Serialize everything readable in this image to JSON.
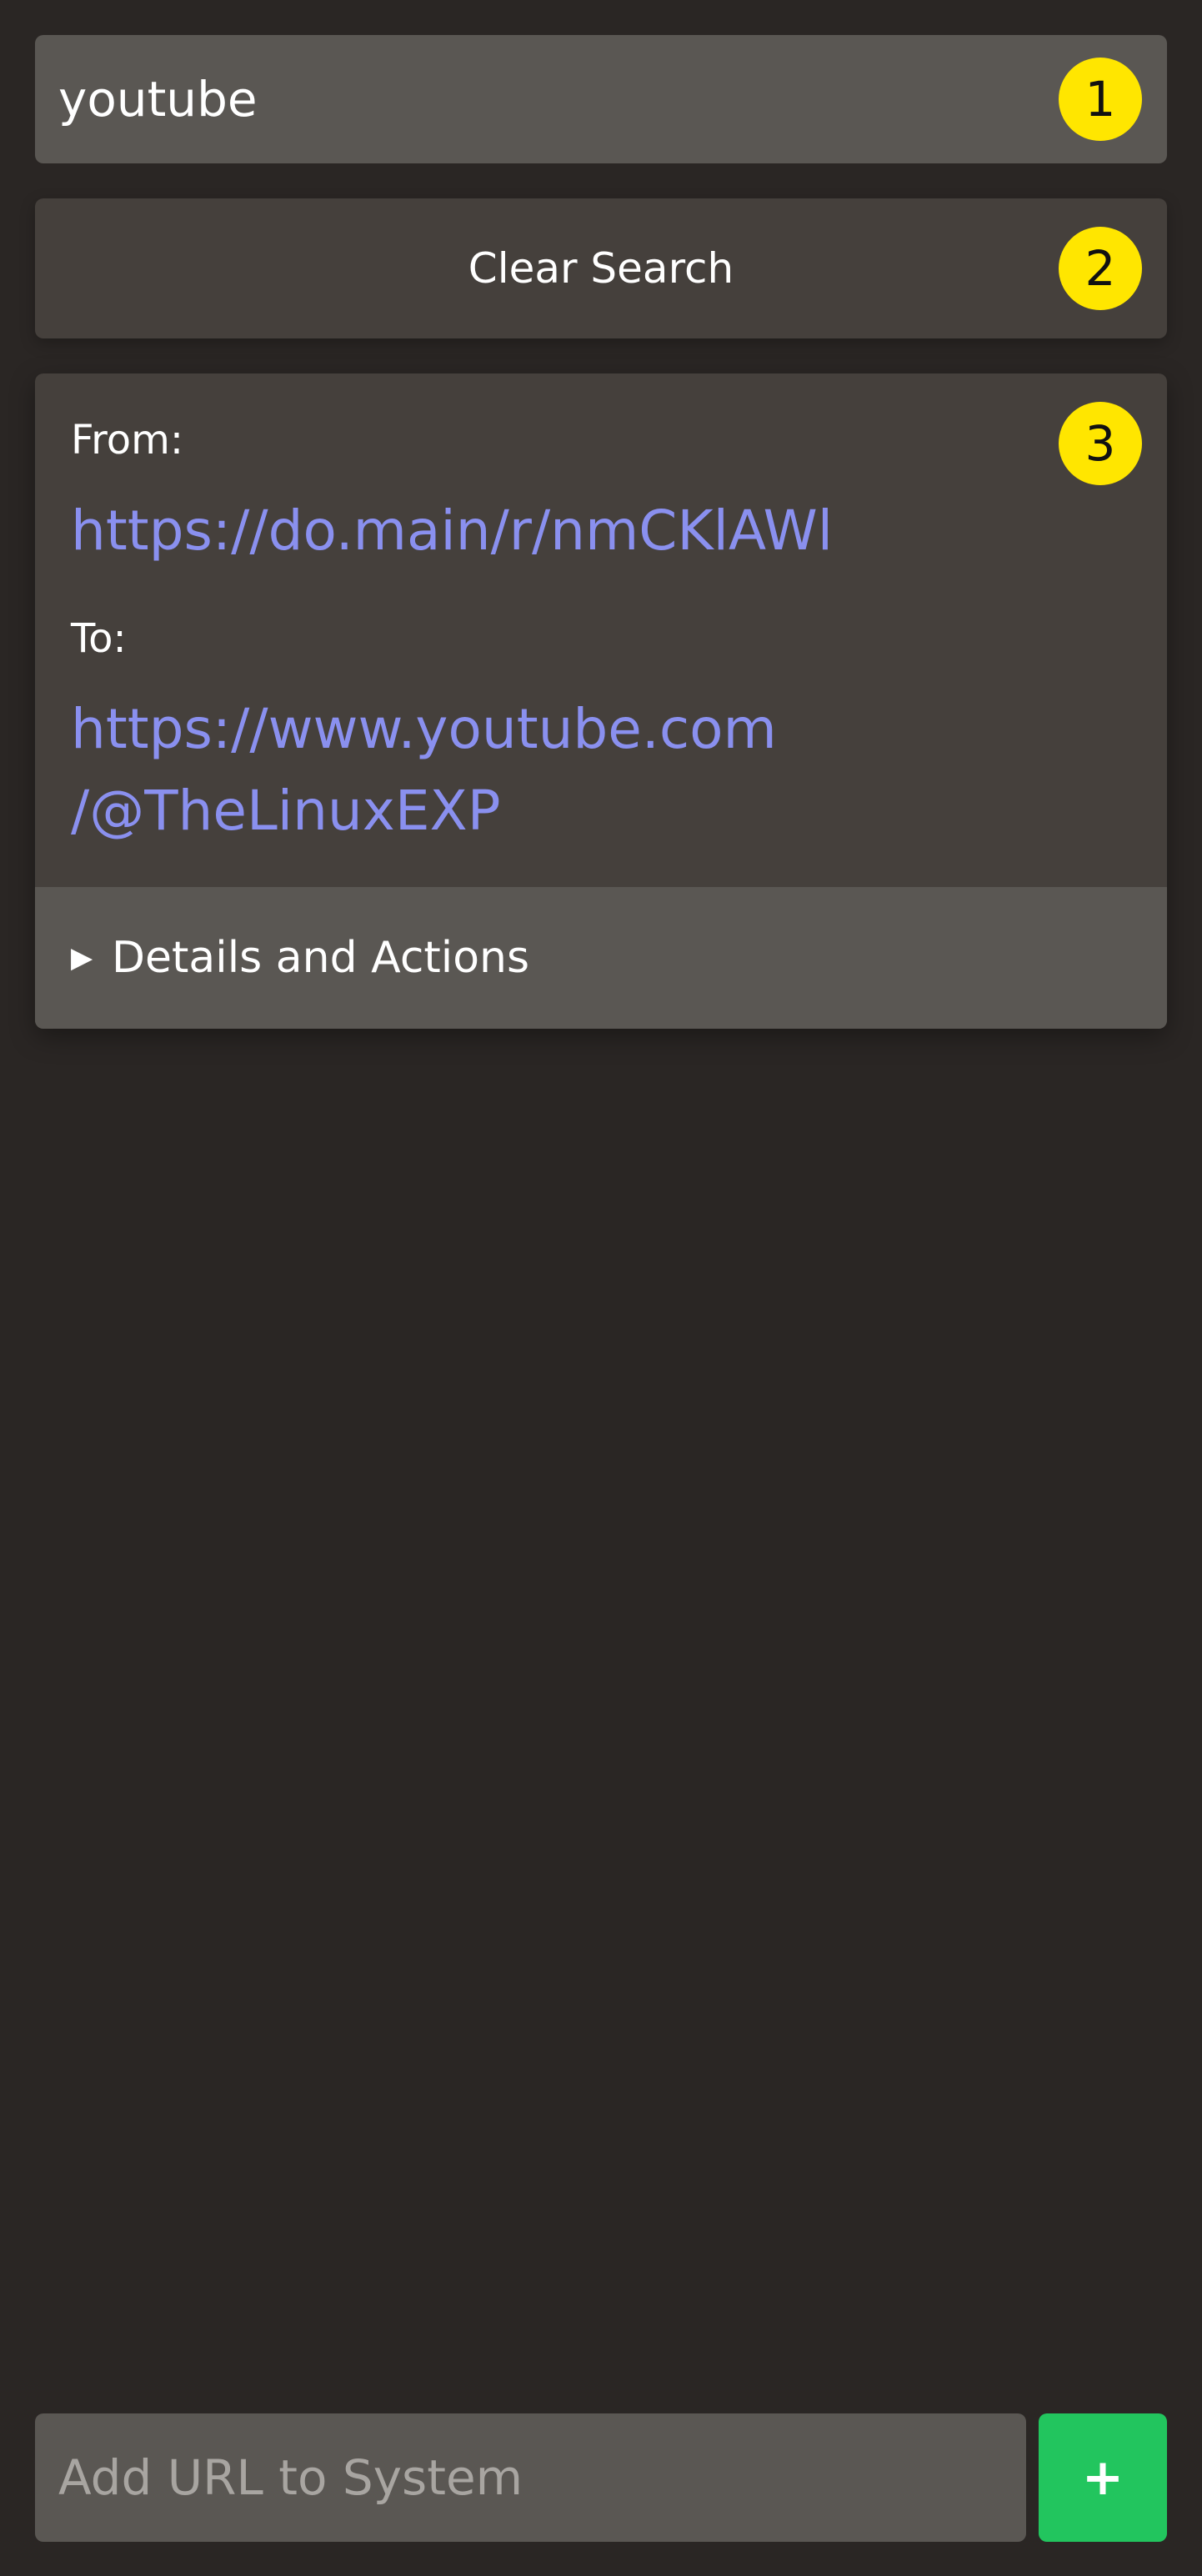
{
  "search": {
    "value": "youtube",
    "badge": "1"
  },
  "clear": {
    "label": "Clear Search",
    "badge": "2"
  },
  "redirect": {
    "badge": "3",
    "from_label": "From:",
    "from_url": "https://do.main/r/nmCKlAWl",
    "to_label": "To:",
    "to_url_line1": "https://www.youtube.com",
    "to_url_line2": "/@TheLinuxEXP",
    "details_arrow": "▶",
    "details_label": "Details and Actions"
  },
  "add": {
    "placeholder": "Add URL to System",
    "button_label": "+"
  },
  "colors": {
    "background": "#2a2624",
    "card": "#45403c",
    "input": "#5a5753",
    "link": "#8a90ef",
    "badge": "#ffe600",
    "add_button": "#22c55e"
  }
}
